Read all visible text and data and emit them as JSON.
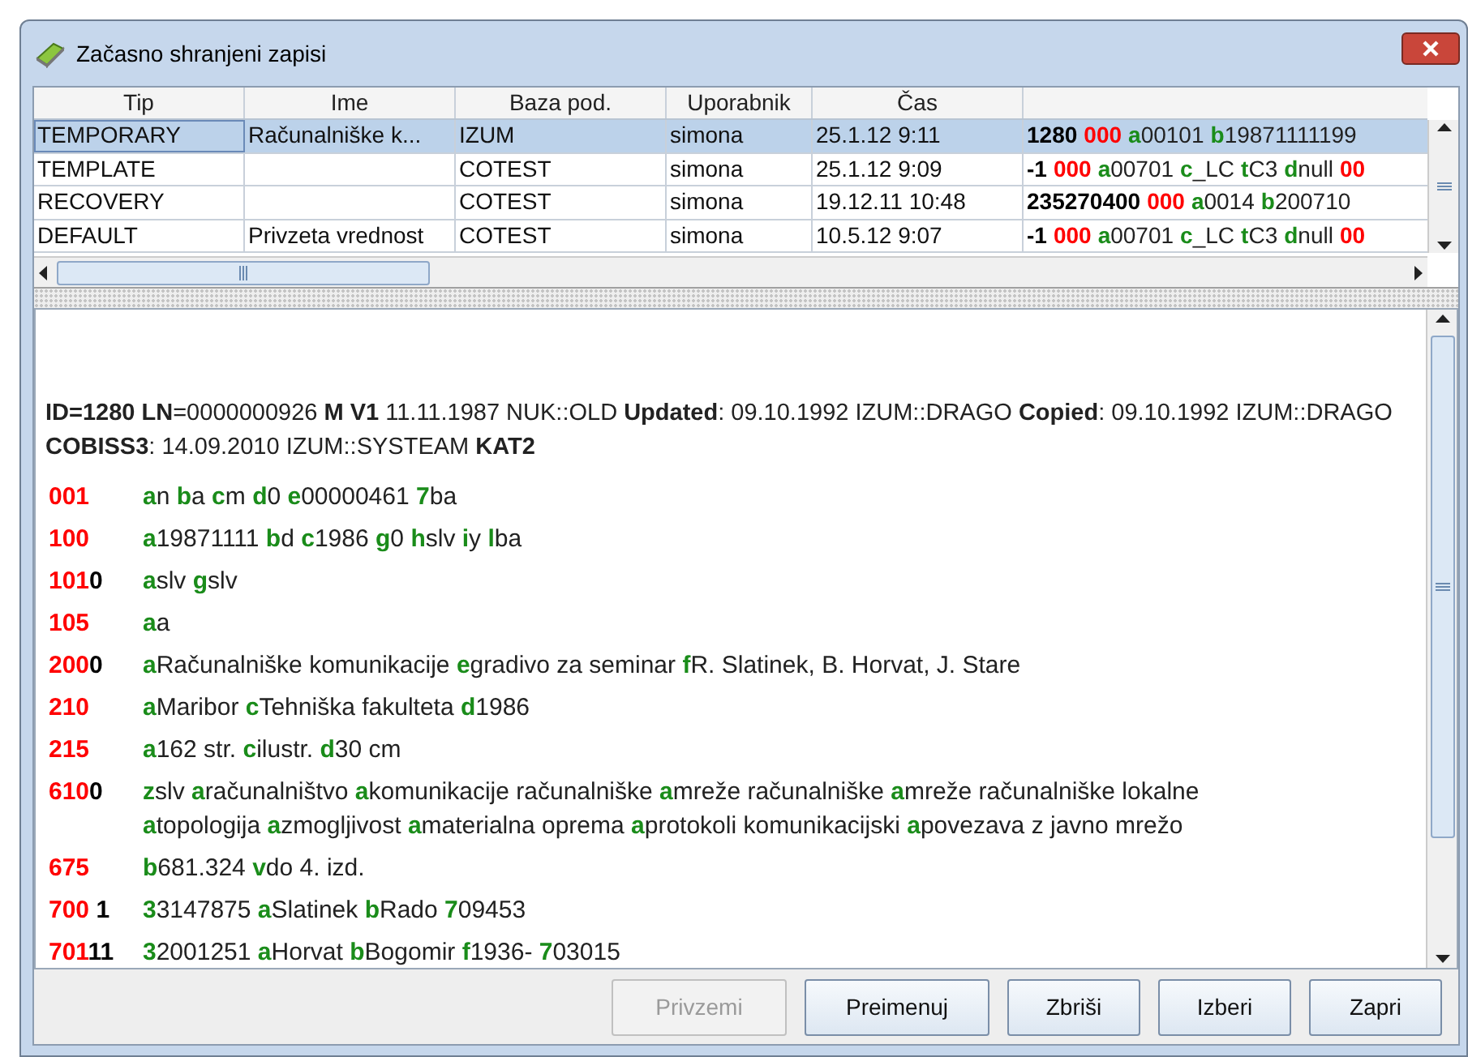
{
  "window": {
    "title": "Začasno shranjeni zapisi"
  },
  "table": {
    "columns": [
      "Tip",
      "Ime",
      "Baza pod.",
      "Uporabnik",
      "Čas"
    ],
    "rows": [
      {
        "selected": true,
        "cells": [
          "TEMPORARY",
          "Računalniške k...",
          "IZUM",
          "simona",
          "25.1.12 9:11"
        ],
        "record": [
          {
            "kind": "id",
            "text": "1280"
          },
          {
            "kind": "tag",
            "text": "000"
          },
          {
            "kind": "code",
            "text": "a"
          },
          {
            "kind": "value",
            "text": "00101"
          },
          {
            "kind": "code",
            "text": "b"
          },
          {
            "kind": "value",
            "text": "19871111199"
          }
        ]
      },
      {
        "selected": false,
        "cells": [
          "TEMPLATE",
          null,
          "COTEST",
          "simona",
          "25.1.12 9:09"
        ],
        "record": [
          {
            "kind": "id",
            "text": "-1"
          },
          {
            "kind": "tag",
            "text": "000"
          },
          {
            "kind": "code",
            "text": "a"
          },
          {
            "kind": "value",
            "text": "00701"
          },
          {
            "kind": "code",
            "text": "c"
          },
          {
            "kind": "value",
            "text": "_LC"
          },
          {
            "kind": "code",
            "text": "t"
          },
          {
            "kind": "value",
            "text": "C3"
          },
          {
            "kind": "code",
            "text": "d"
          },
          {
            "kind": "value",
            "text": "null"
          },
          {
            "kind": "tag",
            "text": "00"
          }
        ]
      },
      {
        "selected": false,
        "cells": [
          "RECOVERY",
          null,
          "COTEST",
          "simona",
          "19.12.11 10:48"
        ],
        "record": [
          {
            "kind": "id",
            "text": "235270400"
          },
          {
            "kind": "tag",
            "text": "000"
          },
          {
            "kind": "code",
            "text": "a"
          },
          {
            "kind": "value",
            "text": "0014"
          },
          {
            "kind": "code",
            "text": "b"
          },
          {
            "kind": "value",
            "text": "200710"
          }
        ]
      },
      {
        "selected": false,
        "cells": [
          "DEFAULT",
          "Privzeta vrednost",
          "COTEST",
          "simona",
          "10.5.12 9:07"
        ],
        "record": [
          {
            "kind": "id",
            "text": "-1"
          },
          {
            "kind": "tag",
            "text": "000"
          },
          {
            "kind": "code",
            "text": "a"
          },
          {
            "kind": "value",
            "text": "00701"
          },
          {
            "kind": "code",
            "text": "c"
          },
          {
            "kind": "value",
            "text": "_LC"
          },
          {
            "kind": "code",
            "text": "t"
          },
          {
            "kind": "value",
            "text": "C3"
          },
          {
            "kind": "code",
            "text": "d"
          },
          {
            "kind": "value",
            "text": "null"
          },
          {
            "kind": "tag",
            "text": "00"
          }
        ]
      }
    ]
  },
  "record_view": {
    "header": "**ID=1280 LN**=0000000926 **M V1** 11.11.1987 NUK::OLD **Updated**: 09.10.1992 IZUM::DRAGO **Copied**: 09.10.1992 IZUM::DRAGO **COBISS3**: 14.09.2010 IZUM::SYSTEAM **KAT2**",
    "fields": [
      {
        "tag": "001",
        "subfields": [
          {
            "code": "a",
            "value": "n"
          },
          {
            "code": "b",
            "value": "a"
          },
          {
            "code": "c",
            "value": "m"
          },
          {
            "code": "d",
            "value": "0"
          },
          {
            "code": "e",
            "value": "00000461"
          },
          {
            "code": "7",
            "value": "ba"
          }
        ]
      },
      {
        "tag": "100",
        "subfields": [
          {
            "code": "a",
            "value": "19871111"
          },
          {
            "code": "b",
            "value": "d"
          },
          {
            "code": "c",
            "value": "1986"
          },
          {
            "code": "g",
            "value": "0"
          },
          {
            "code": "h",
            "value": "slv"
          },
          {
            "code": "i",
            "value": "y"
          },
          {
            "code": "l",
            "value": "ba"
          }
        ]
      },
      {
        "tag": "101",
        "indicators": "0",
        "subfields": [
          {
            "code": "a",
            "value": "slv"
          },
          {
            "code": "g",
            "value": "slv"
          }
        ]
      },
      {
        "tag": "105",
        "subfields": [
          {
            "code": "a",
            "value": "a"
          }
        ]
      },
      {
        "tag": "200",
        "indicators": "0",
        "subfields": [
          {
            "code": "a",
            "value": "Računalniške komunikacije"
          },
          {
            "code": "e",
            "value": "gradivo za seminar"
          },
          {
            "code": "f",
            "value": "R. Slatinek, B. Horvat, J. Stare"
          }
        ]
      },
      {
        "tag": "210",
        "subfields": [
          {
            "code": "a",
            "value": "Maribor"
          },
          {
            "code": "c",
            "value": "Tehniška fakulteta"
          },
          {
            "code": "d",
            "value": "1986"
          }
        ]
      },
      {
        "tag": "215",
        "subfields": [
          {
            "code": "a",
            "value": "162 str."
          },
          {
            "code": "c",
            "value": "ilustr."
          },
          {
            "code": "d",
            "value": "30 cm"
          }
        ]
      },
      {
        "tag": "610",
        "indicators": "0",
        "subfields": [
          {
            "code": "z",
            "value": "slv"
          },
          {
            "code": "a",
            "value": "računalništvo"
          },
          {
            "code": "a",
            "value": "komunikacije računalniške"
          },
          {
            "code": "a",
            "value": "mreže računalniške"
          },
          {
            "code": "a",
            "value": "mreže računalniške lokalne"
          },
          {
            "code": "a",
            "value": "topologija"
          },
          {
            "code": "a",
            "value": "zmogljivost"
          },
          {
            "code": "a",
            "value": "materialna oprema"
          },
          {
            "code": "a",
            "value": "protokoli komunikacijski"
          },
          {
            "code": "a",
            "value": "povezava z javno mrežo"
          }
        ]
      },
      {
        "tag": "675",
        "subfields": [
          {
            "code": "b",
            "value": "681.324"
          },
          {
            "code": "v",
            "value": "do 4. izd."
          }
        ]
      },
      {
        "tag": "700",
        "indicators": " 1",
        "subfields": [
          {
            "code": "3",
            "value": "3147875"
          },
          {
            "code": "a",
            "value": "Slatinek"
          },
          {
            "code": "b",
            "value": "Rado"
          },
          {
            "code": "7",
            "value": "09453"
          }
        ]
      },
      {
        "tag": "701",
        "indicators": "11",
        "subfields": [
          {
            "code": "3",
            "value": "2001251"
          },
          {
            "code": "a",
            "value": "Horvat"
          },
          {
            "code": "b",
            "value": "Bogomir"
          },
          {
            "code": "f",
            "value": "1936-"
          },
          {
            "code": "7",
            "value": "03015"
          }
        ]
      }
    ]
  },
  "buttons": [
    {
      "label": "Privzemi",
      "disabled": true
    },
    {
      "label": "Preimenuj",
      "disabled": false
    },
    {
      "label": "Zbriši",
      "disabled": false
    },
    {
      "label": "Izberi",
      "disabled": false
    },
    {
      "label": "Zapri",
      "disabled": false
    }
  ]
}
